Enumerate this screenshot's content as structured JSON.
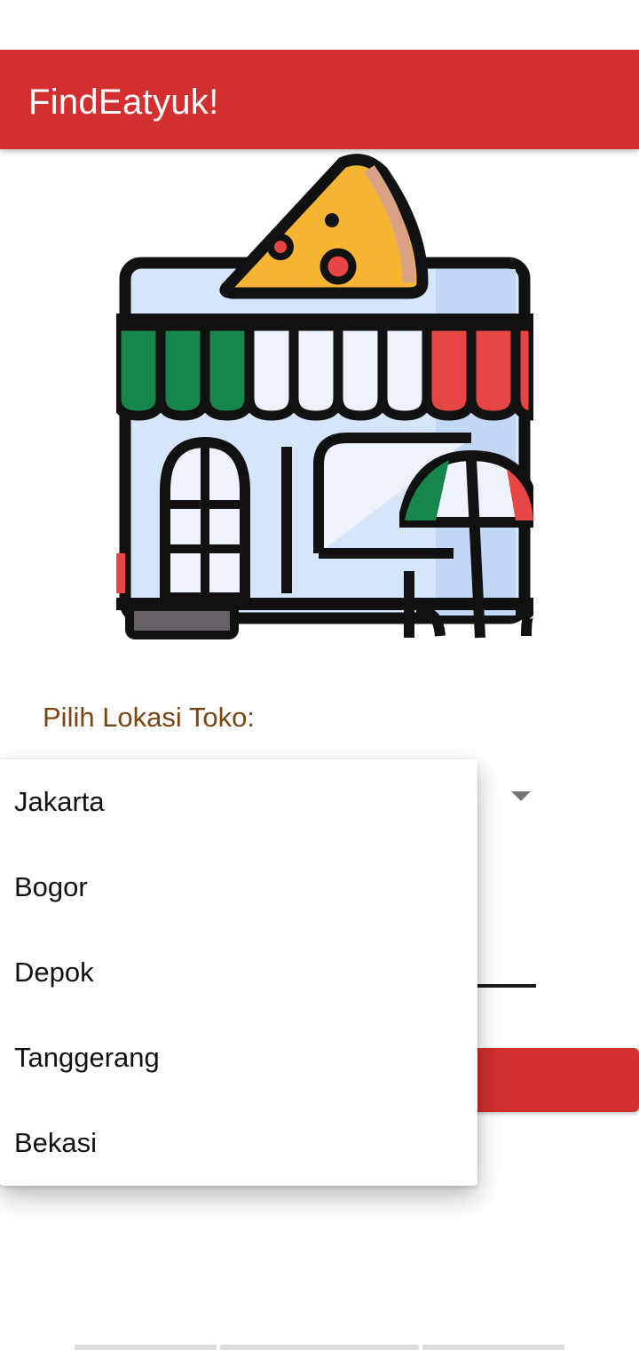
{
  "app": {
    "title": "FindEatyuk!"
  },
  "form": {
    "location_label": "Pilih Lokasi Toko:"
  },
  "dropdown": {
    "options": [
      "Jakarta",
      "Bogor",
      "Depok",
      "Tanggerang",
      "Bekasi"
    ]
  },
  "colors": {
    "primary": "#d32f2f",
    "label": "#7a4514",
    "awning_green": "#16864d",
    "awning_red": "#e84545",
    "building": "#cfe0f7",
    "pizza": "#f5b431"
  },
  "icons": {
    "hero": "pizza-shop-icon",
    "spinner": "dropdown-arrow-icon"
  }
}
